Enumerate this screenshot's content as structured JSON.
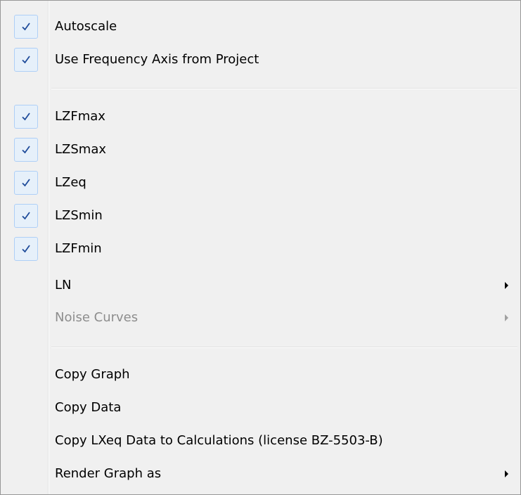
{
  "menu": {
    "items": [
      {
        "label": "Autoscale",
        "checked": true
      },
      {
        "label": "Use Frequency Axis from Project",
        "checked": true
      },
      {
        "label": "LZFmax",
        "checked": true
      },
      {
        "label": "LZSmax",
        "checked": true
      },
      {
        "label": "LZeq",
        "checked": true
      },
      {
        "label": "LZSmin",
        "checked": true
      },
      {
        "label": "LZFmin",
        "checked": true
      },
      {
        "label": "LN",
        "checked": false,
        "submenu": true
      },
      {
        "label": "Noise Curves",
        "checked": false,
        "submenu": true,
        "disabled": true
      },
      {
        "label": "Copy Graph",
        "checked": false
      },
      {
        "label": "Copy Data",
        "checked": false
      },
      {
        "label": "Copy LXeq Data to Calculations (license BZ-5503-B)",
        "checked": false
      },
      {
        "label": "Render Graph as",
        "checked": false,
        "submenu": true
      }
    ],
    "check_icon": "checkmark-icon",
    "submenu_icon": "submenu-arrow-icon",
    "colors": {
      "check_color": "#1e4b9a",
      "check_box_bg": "#e6f0fa",
      "check_box_border": "#aecff7",
      "disabled_text": "#8d8d8d"
    }
  }
}
